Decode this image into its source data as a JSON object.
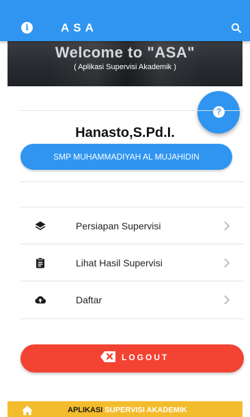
{
  "appbar": {
    "title": "ASA",
    "info_icon": "info-icon",
    "search_icon": "search-icon",
    "color": "#2f95f0"
  },
  "banner": {
    "welcome": "Welcome to \"ASA\"",
    "tagline": "( Aplikasi Supervisi Akademik )"
  },
  "help_fab": {
    "icon": "help-icon"
  },
  "profile": {
    "name": "Hanasto,S.Pd.I.",
    "school": "SMP MUHAMMADIYAH AL MUJAHIDIN"
  },
  "menu": {
    "items": [
      {
        "label": "Persiapan Supervisi",
        "icon": "layers-icon"
      },
      {
        "label": "Lihat Hasil Supervisi",
        "icon": "clipboard-icon"
      },
      {
        "label": "Daftar",
        "icon": "cloud-upload-icon"
      }
    ]
  },
  "logout": {
    "label": "LOGOUT",
    "icon": "backspace-icon",
    "color": "#f24333"
  },
  "bottom_bar": {
    "home_icon": "home-icon",
    "text_part1": "APLIKASI",
    "text_part2": "SUPERVISI AKADEMIK",
    "color": "#f3bc2c"
  }
}
